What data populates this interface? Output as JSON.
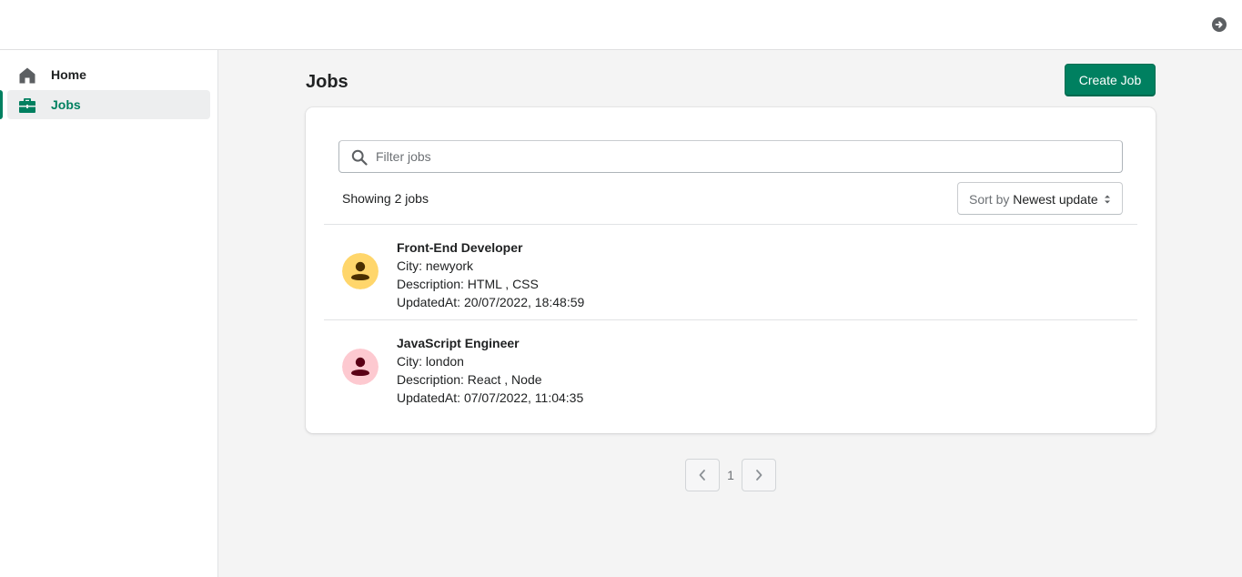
{
  "topbar": {
    "logout_icon": "arrow-right-circle-icon"
  },
  "sidebar": {
    "items": [
      {
        "label": "Home",
        "icon": "home-icon",
        "active": false
      },
      {
        "label": "Jobs",
        "icon": "briefcase-icon",
        "active": true
      }
    ]
  },
  "page": {
    "title": "Jobs",
    "create_button": "Create Job"
  },
  "filter": {
    "placeholder": "Filter jobs",
    "value": ""
  },
  "results": {
    "showing_text": "Showing 2 jobs",
    "sort_prefix": "Sort by",
    "sort_value": "Newest update"
  },
  "jobs": [
    {
      "title": "Front-End Developer",
      "city": "City: newyork",
      "description": "Description: HTML , CSS",
      "updated": "UpdatedAt: 20/07/2022, 18:48:59",
      "avatar_bg": "#ffd66b",
      "avatar_fg": "#4a2f00"
    },
    {
      "title": "JavaScript Engineer",
      "city": "City: london",
      "description": "Description: React , Node",
      "updated": "UpdatedAt: 07/07/2022, 11:04:35",
      "avatar_bg": "#fdc9d0",
      "avatar_fg": "#5a0015"
    }
  ],
  "pagination": {
    "current_page": "1"
  },
  "colors": {
    "accent": "#008060",
    "background": "#f4f4f4"
  }
}
